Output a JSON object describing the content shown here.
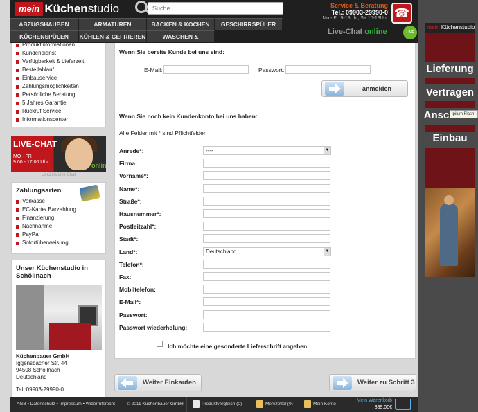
{
  "header": {
    "logo_mein": "mein",
    "logo_kuechen": "Küchen",
    "logo_studio": "studio",
    "search_placeholder": "Suche",
    "service_title": "Service & Beratung",
    "service_phone": "Tel.: 09903-29990-0",
    "service_hours": "Mo.- Fr. 9-18Uhr, Sa.10-13Uhr",
    "livechat_text": "Live-Chat",
    "livechat_status": "online",
    "livechat_icon_text": "LIVE CHAT"
  },
  "nav": {
    "row1": [
      "ABZUGSHAUBEN",
      "ARMATUREN",
      "BACKEN & KOCHEN",
      "GESCHIRRSPÜLER"
    ],
    "row2": [
      "KÜCHENSPÜLEN",
      "KÜHLEN & GEFRIEREN",
      "WASCHEN & TROCKNEN"
    ]
  },
  "sidebar": {
    "info_items": [
      "Produktinformationen",
      "Kundendienst",
      "Verfügbarkeit & Lieferzeit",
      "Bestellablauf",
      "Einbauservice",
      "Zahlungsmöglichkeiten",
      "Persönliche Beratung",
      "5 Jahres Garantie",
      "Rückruf Service",
      "Informationscenter"
    ],
    "livechat_banner_title": "LIVE-CHAT",
    "livechat_banner_days": "MO - FR",
    "livechat_banner_hours": "9.00 - 17.00 Uhr",
    "livechat_banner_online": "online",
    "livezilla_label": "LiveZilla Live Chat",
    "payment_title": "Zahlungsarten",
    "payment_items": [
      "Vorkasse",
      "EC-Karte/ Barzahlung",
      "Finanzierung",
      "Nachnahme",
      "PayPal",
      "Sofortüberweisung"
    ],
    "studio_title": "Unser Küchenstudio in Schöllnach",
    "company": "Küchenbauer GmbH",
    "street": "Iggensbacher Str. 44",
    "city": "94508 Schöllnach",
    "country": "Deutschland",
    "phone": "Tel.:09903-29990-0"
  },
  "login": {
    "heading": "Wenn Sie bereits Kunde bei uns sind:",
    "email_label": "E-Mail:",
    "password_label": "Passwort:",
    "submit_label": "anmelden"
  },
  "register": {
    "heading": "Wenn Sie noch kein Kundenkonto bei uns haben:",
    "required_note": "Alle Felder mit * sind Pflichtfelder",
    "fields": [
      {
        "label": "Anrede*:",
        "value": "----",
        "type": "select"
      },
      {
        "label": "Firma:",
        "value": ""
      },
      {
        "label": "Vorname*:",
        "value": ""
      },
      {
        "label": "Name*:",
        "value": ""
      },
      {
        "label": "Straße*:",
        "value": ""
      },
      {
        "label": "Hausnummer*:",
        "value": ""
      },
      {
        "label": "Postleitzahl*:",
        "value": ""
      },
      {
        "label": "Stadt*:",
        "value": ""
      },
      {
        "label": "Land*:",
        "value": "Deutschland",
        "type": "select"
      },
      {
        "label": "Telefon*:",
        "value": ""
      },
      {
        "label": "Fax:",
        "value": ""
      },
      {
        "label": "Mobiltelefon:",
        "value": ""
      },
      {
        "label": "E-Mail*:",
        "value": ""
      },
      {
        "label": "Passwort:",
        "value": ""
      },
      {
        "label": "Passwort wiederholung:",
        "value": ""
      }
    ],
    "delivery_checkbox_label": "Ich möchte eine gesonderte Lieferschrift angeben.",
    "delivery_checked": false
  },
  "actions": {
    "back_label": "Weiter Einkaufen",
    "next_label": "Weiter zu Schritt 3"
  },
  "right_banner": {
    "logo_mein": "mein",
    "logo_rest": "Küchenstudio",
    "words": [
      "Lieferung",
      "Vertragen",
      "Ansc",
      "Einbau"
    ],
    "tooltip": "Ipilum Flash"
  },
  "footer": {
    "links": "AGB • Datenschutz • Impressum • Widerrufsrecht",
    "copyright": "© 2011 Küchenbauer GmbH",
    "compare": "Produktvergleich (0)",
    "notes": "Merkzettel (0)",
    "account": "Mein Konto",
    "cart_label": "Mein Warenkorb",
    "cart_total": "389,00€"
  },
  "colors": {
    "brand_red": "#c0171c",
    "header_bg": "#1f1f1f",
    "service_orange": "#e05a1a",
    "online_green": "#2fb23b"
  }
}
